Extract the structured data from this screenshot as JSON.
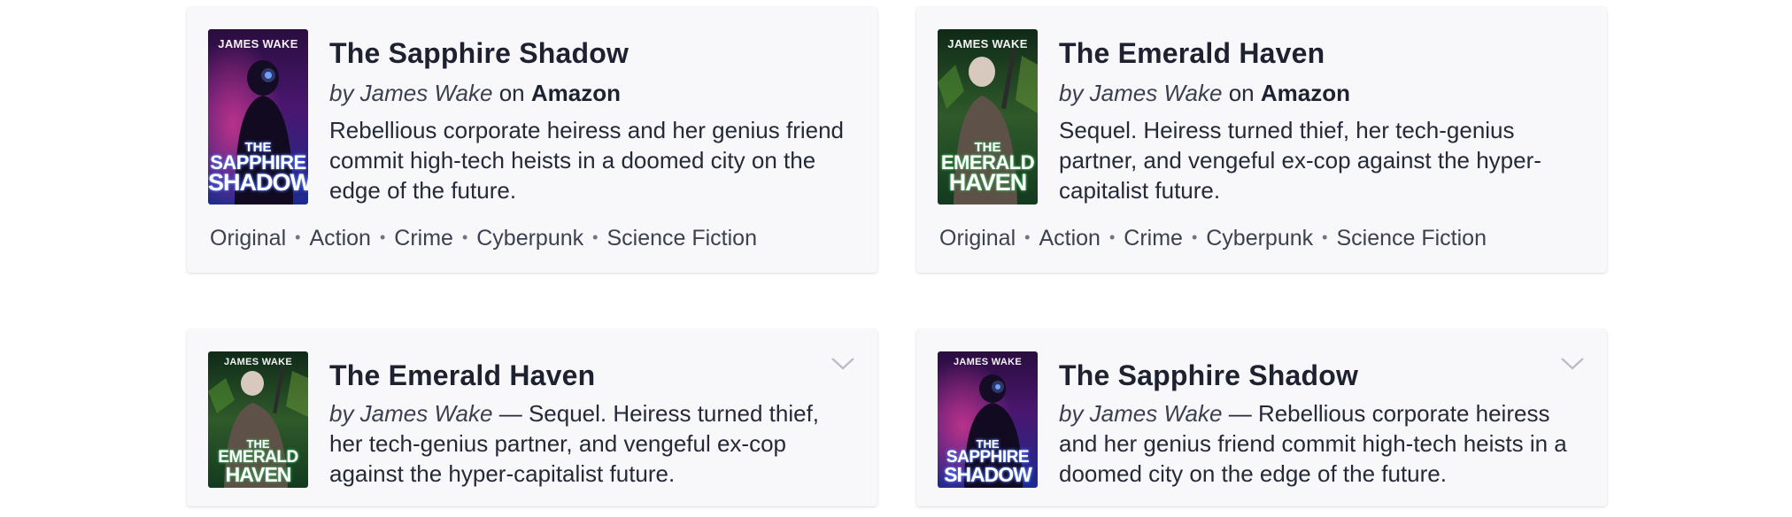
{
  "cards": [
    {
      "title": "The Sapphire Shadow",
      "by": "by James Wake",
      "on": "on",
      "store": "Amazon",
      "description": "Rebellious corporate heiress and her genius friend commit high-tech heists in a doomed city on the edge of the future.",
      "tags": [
        "Original",
        "Action",
        "Crime",
        "Cyberpunk",
        "Science Fiction"
      ],
      "cover": {
        "author": "JAMES WAKE",
        "t1": "THE",
        "t2": "SAPPHIRE",
        "t3": "SHADOW",
        "theme": "blue"
      }
    },
    {
      "title": "The Emerald Haven",
      "by": "by James Wake",
      "on": "on",
      "store": "Amazon",
      "description": "Sequel. Heiress turned thief, her tech-genius partner, and vengeful ex-cop against the hyper-capitalist future.",
      "tags": [
        "Original",
        "Action",
        "Crime",
        "Cyberpunk",
        "Science Fiction"
      ],
      "cover": {
        "author": "JAMES WAKE",
        "t1": "THE",
        "t2": "EMERALD",
        "t3": "HAVEN",
        "theme": "green"
      }
    },
    {
      "title": "The Emerald Haven",
      "by": "by James Wake",
      "separator": " — ",
      "description": "Sequel. Heiress turned thief, her tech-genius partner, and vengeful ex-cop against the hyper-capitalist future.",
      "expand_icon": "chevron-down-icon",
      "cover": {
        "author": "JAMES WAKE",
        "t1": "THE",
        "t2": "EMERALD",
        "t3": "HAVEN",
        "theme": "green"
      }
    },
    {
      "title": "The Sapphire Shadow",
      "by": "by James Wake",
      "separator": " — ",
      "description": "Rebellious corporate heiress and her genius friend commit high-tech heists in a doomed city on the edge of the future.",
      "expand_icon": "chevron-down-icon",
      "cover": {
        "author": "JAMES WAKE",
        "t1": "THE",
        "t2": "SAPPHIRE",
        "t3": "SHADOW",
        "theme": "blue"
      }
    }
  ],
  "colors": {
    "card_bg": "#f8f8fb",
    "text": "#1e2130",
    "muted": "#3d4150"
  }
}
